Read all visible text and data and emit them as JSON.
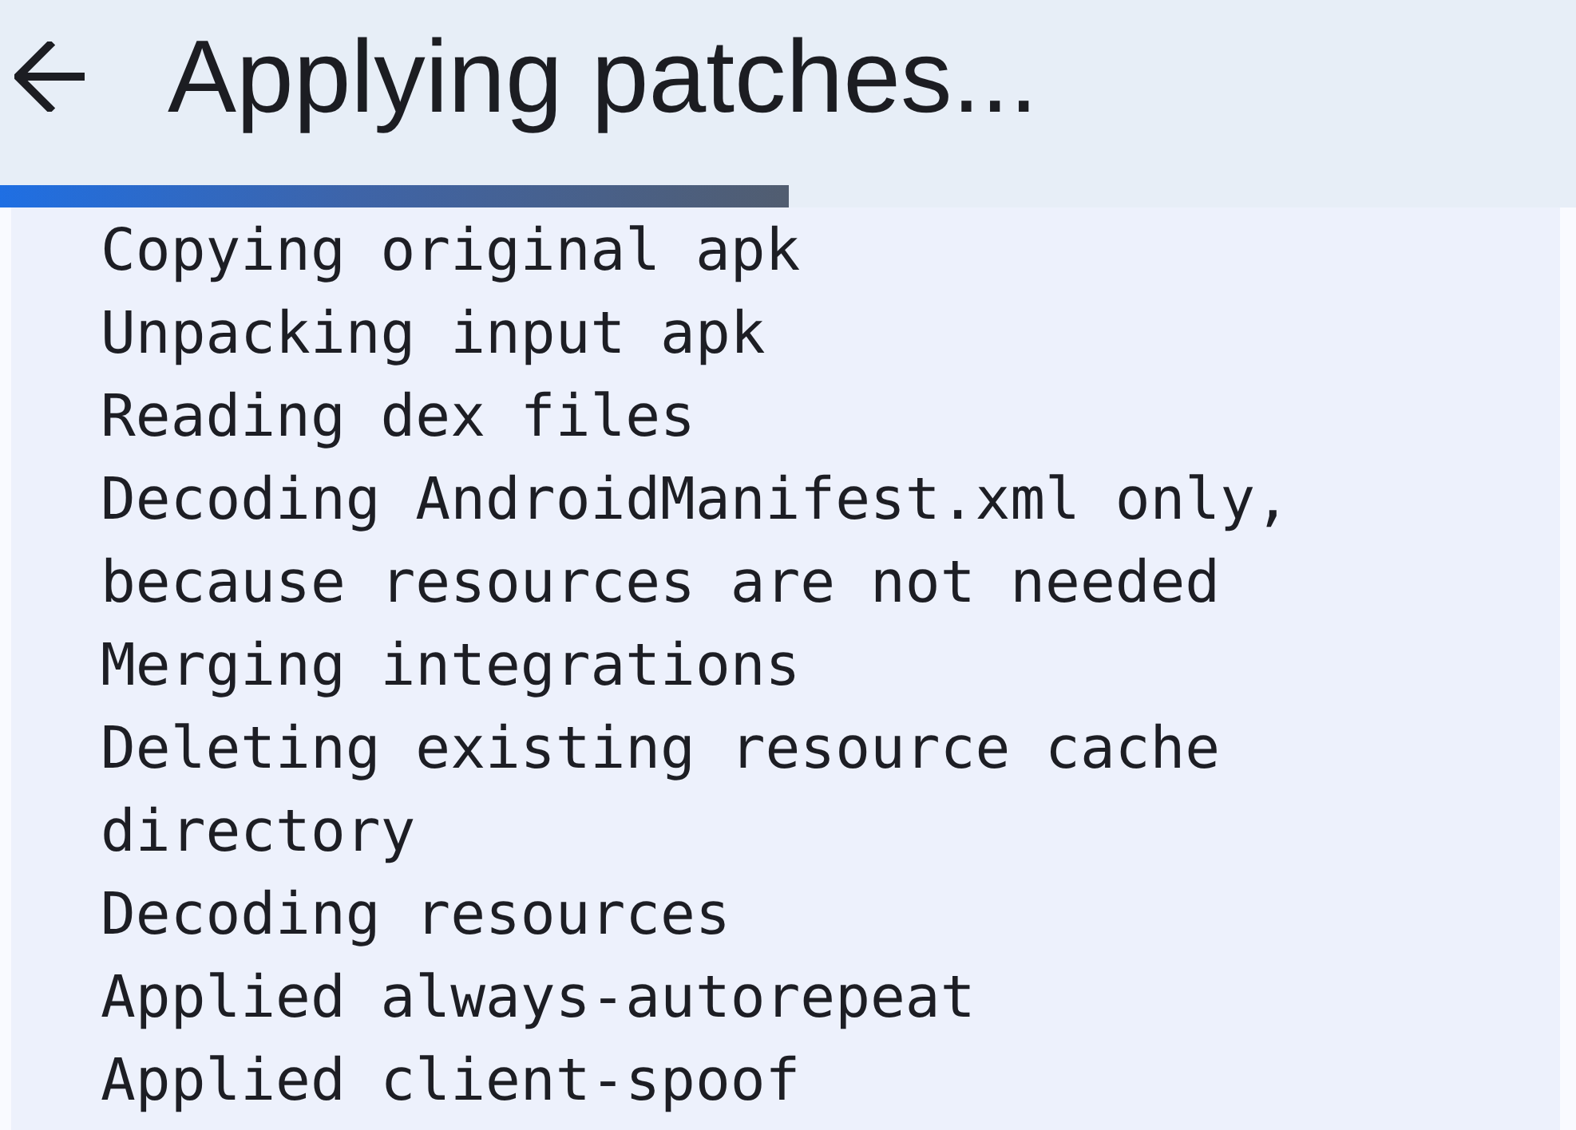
{
  "top_bar": {
    "title": "Applying patches..."
  },
  "progress": {
    "level": 0.5
  },
  "log": {
    "lines": [
      "Copying original apk",
      "Unpacking input apk",
      "Reading dex files",
      "Decoding AndroidManifest.xml only, because resources are not needed",
      "Merging integrations",
      "Deleting existing resource cache directory",
      "Decoding resources",
      "Applied always-autorepeat",
      "Applied client-spoof"
    ]
  }
}
